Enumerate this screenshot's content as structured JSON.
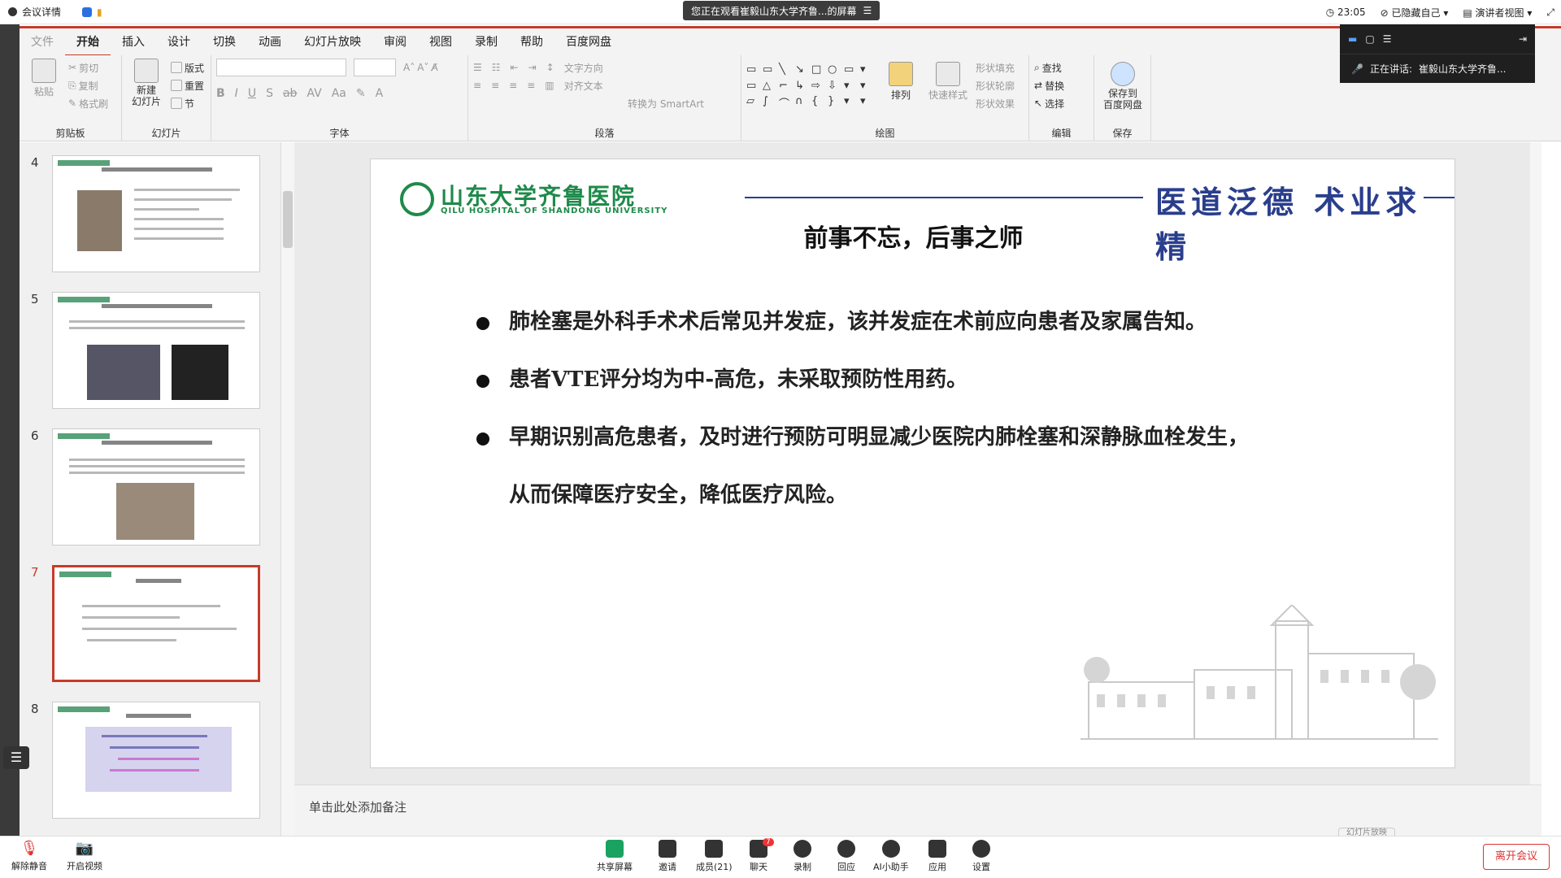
{
  "meeting": {
    "details": "会议详情",
    "viewing_banner": "您正在观看崔毅山东大学齐鲁...的屏幕",
    "time": "23:05",
    "hide_self": "已隐藏自己",
    "presenter_view": "演讲者视图",
    "speaking": "正在讲话:",
    "speaker_name": "崔毅山东大学齐鲁..."
  },
  "ppt": {
    "file_tab": "文件",
    "tabs": [
      "开始",
      "插入",
      "设计",
      "切换",
      "动画",
      "幻灯片放映",
      "审阅",
      "视图",
      "录制",
      "帮助",
      "百度网盘"
    ],
    "ribbon": {
      "paste": "粘贴",
      "cut": "剪切",
      "copy": "复制",
      "format_painter": "格式刷",
      "clipboard": "剪贴板",
      "new_slide": "新建\n幻灯片",
      "layout": "版式",
      "reset": "重置",
      "section": "节",
      "slides": "幻灯片",
      "font": "字体",
      "text_direction": "文字方向",
      "align_text": "对齐文本",
      "convert_smartart": "转换为 SmartArt",
      "paragraph": "段落",
      "arrange": "排列",
      "quick_styles": "快速样式",
      "shape_fill": "形状填充",
      "shape_outline": "形状轮廓",
      "shape_effects": "形状效果",
      "drawing": "绘图",
      "find": "查找",
      "replace": "替换",
      "select": "选择",
      "editing": "编辑",
      "save_baidu": "保存到\n百度网盘",
      "save": "保存"
    },
    "thumbnails": [
      {
        "num": "4"
      },
      {
        "num": "5"
      },
      {
        "num": "6"
      },
      {
        "num": "7"
      },
      {
        "num": "8"
      }
    ],
    "slide": {
      "logo_cn": "山东大学齐鲁医院",
      "logo_en": "QILU HOSPITAL OF SHANDONG UNIVERSITY",
      "motto": "医道泛德 术业求精",
      "title": "前事不忘，后事之师",
      "bullets": [
        "肺栓塞是外科手术术后常见并发症，该并发症在术前应向患者及家属告知。",
        "患者VTE评分均为中-高危，未采取预防性用药。",
        "早期识别高危患者，及时进行预防可明显减少医院内肺栓塞和深静脉血栓发生，"
      ],
      "bullet_cont": "从而保障医疗安全，降低医疗风险。"
    },
    "notes_placeholder": "单击此处添加备注",
    "slideshow_tab": "幻灯片放映"
  },
  "toolbar": {
    "unmute": "解除静音",
    "start_video": "开启视频",
    "share_screen": "共享屏幕",
    "invite": "邀请",
    "members": "成员(21)",
    "chat": "聊天",
    "record": "录制",
    "reactions": "回应",
    "ai_assistant": "AI小助手",
    "apps": "应用",
    "settings": "设置",
    "leave": "离开会议",
    "chat_badge": "7"
  },
  "colors": {
    "accent": "#c63b2a",
    "hospital_green": "#1e8a4a",
    "motto_blue": "#2a3e8c"
  }
}
